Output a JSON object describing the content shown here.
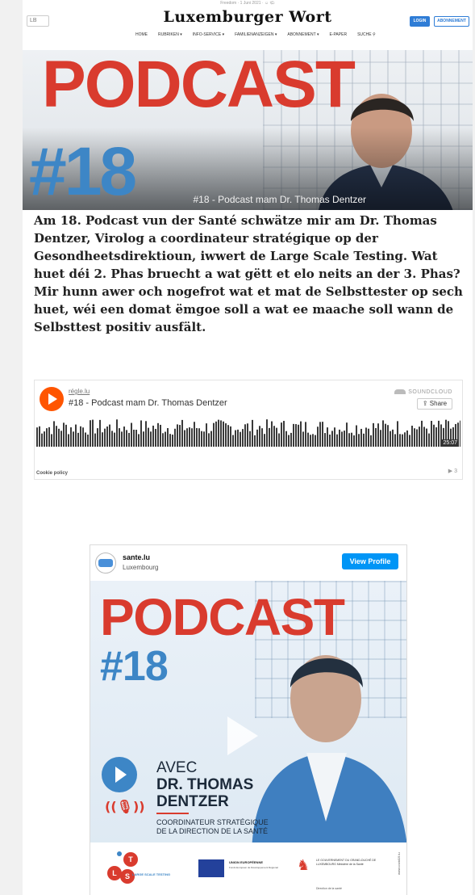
{
  "header": {
    "dateline": "Freedom · 1 Juni 2021 · ☺ 🌤",
    "lang": "LB",
    "logo": "Luxemburger Wort",
    "login_label": "LOGIN",
    "abo_label": "ABONNEMENT",
    "nav": [
      "HOME",
      "RUBRIKEN ▾",
      "INFO-SERVICE ▾",
      "FAMILIENANZEIGEN ▾",
      "ABONNEMENT ▾",
      "E-PAPER",
      "SUCHE ⚲"
    ]
  },
  "hero": {
    "podcast": "PODCAST",
    "number": "#18",
    "caption": "#18 - Podcast mam Dr. Thomas Dentzer"
  },
  "article": {
    "body": "Am 18. Podcast vun der Santé schwätze mir am Dr. Thomas Dentzer, Virolog a coordinateur stratégique op der Gesondheetsdirektioun, iwwert de Large Scale Testing. Wat huet déi 2. Phas bruecht a wat gëtt et elo neits an der 3. Phas? Mir hunn awer och nogefrot wat et mat de Selbsttester op sech huet, wéi een domat ëmgoe soll a wat ee maache soll wann de Selbsttest positiv ausfält."
  },
  "soundcloud": {
    "user": "régle.lu",
    "track_title": "#18 - Podcast mam Dr. Thomas Dentzer",
    "brand": "SOUNDCLOUD",
    "share_label": "Share",
    "duration": "25:07",
    "cookie_label": "Cookie policy",
    "play_count": "▶ 3",
    "wave_color": "#3a3a3a",
    "accent": "#ff5500"
  },
  "instagram": {
    "account": "sante.lu",
    "location": "Luxembourg",
    "view_profile": "View Profile",
    "podcast": "PODCAST",
    "number": "#18",
    "avec": "AVEC",
    "dr": "DR. THOMAS",
    "dentzer": "DENTZER",
    "role_line1": "COORDINATEUR STRATÉGIQUE",
    "role_line2": "DE LA DIRECTION DE LA SANTÉ",
    "ls_text": "LARGE SCALE TESTING",
    "eu_title": "UNION EUROPÉENNE",
    "eu_sub": "Fonds Européen de Développement Régional",
    "gov_text": "LE GOUVERNEMENT DU GRAND-DUCHÉ DE LUXEMBOURG Ministère de la Santé",
    "dir_text": "Direction de la santé",
    "www": "www.covid19.lu",
    "colors": {
      "red": "#d93b2e",
      "blue": "#3d86c6",
      "ig_button": "#0095f6"
    }
  }
}
